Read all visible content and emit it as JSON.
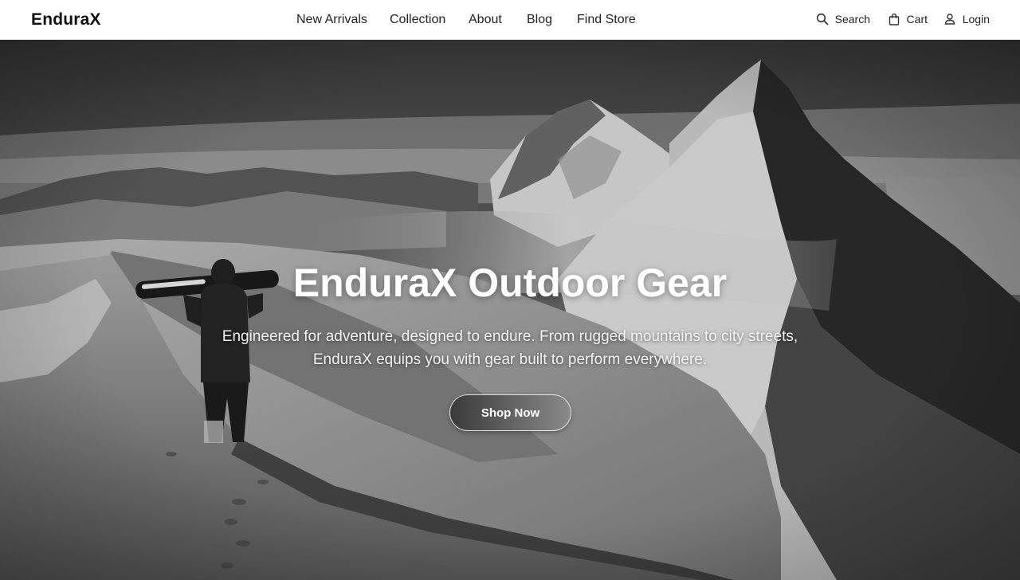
{
  "brand": {
    "logo": "EnduraX"
  },
  "nav": {
    "items": [
      {
        "label": "New Arrivals"
      },
      {
        "label": "Collection"
      },
      {
        "label": "About"
      },
      {
        "label": "Blog"
      },
      {
        "label": "Find Store"
      }
    ]
  },
  "actions": {
    "search": {
      "label": "Search",
      "icon": "search-icon"
    },
    "cart": {
      "label": "Cart",
      "icon": "shopping-bag-icon"
    },
    "login": {
      "label": "Login",
      "icon": "user-icon"
    }
  },
  "hero": {
    "title": "EnduraX Outdoor Gear",
    "subtitle_line1": "Engineered for adventure, designed to endure. From rugged mountains to city streets,",
    "subtitle_line2": "EnduraX equips you with gear built to perform everywhere.",
    "cta_label": "Shop Now",
    "image": "grayscale-mountain-ridge-with-snowboarder"
  }
}
